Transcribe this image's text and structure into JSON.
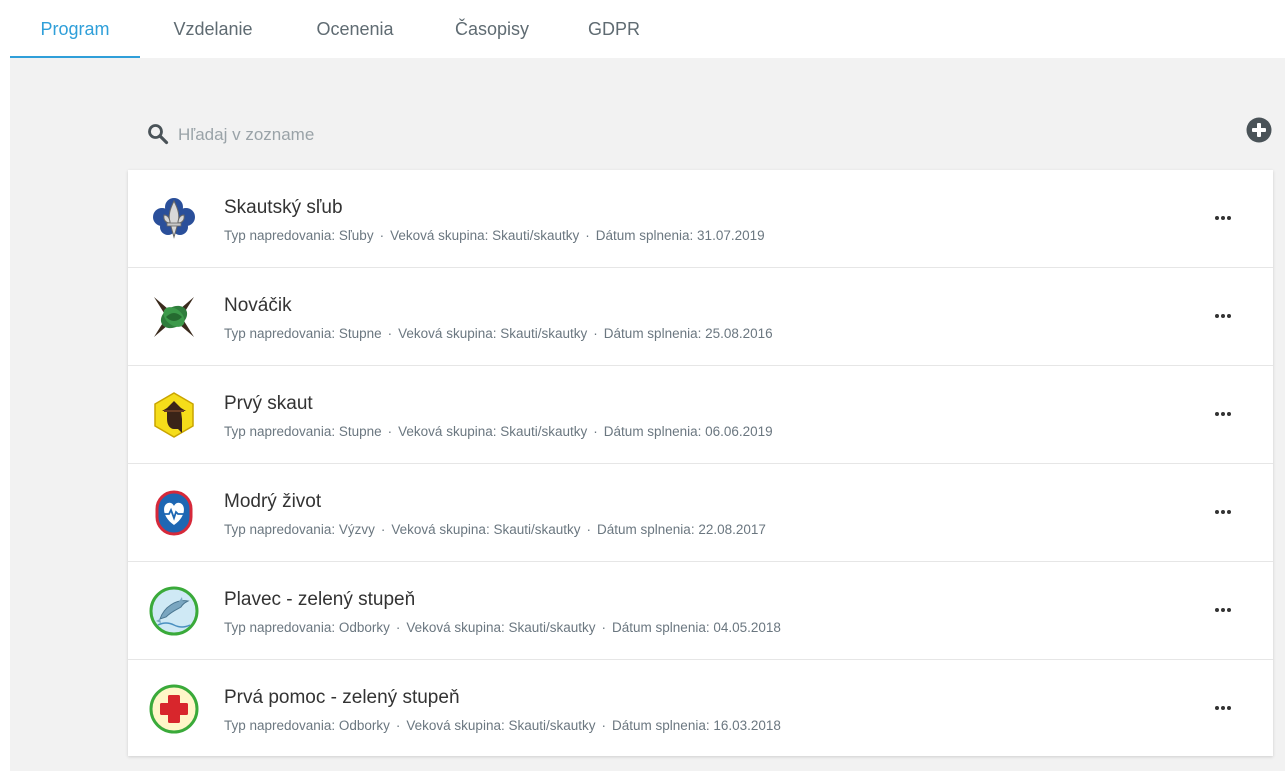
{
  "tabs": [
    {
      "label": "Program",
      "active": true
    },
    {
      "label": "Vzdelanie",
      "active": false
    },
    {
      "label": "Ocenenia",
      "active": false
    },
    {
      "label": "Časopisy",
      "active": false
    },
    {
      "label": "GDPR",
      "active": false
    }
  ],
  "colors": {
    "accent": "#2f9fd9",
    "background": "#f2f2f2"
  },
  "search": {
    "placeholder": "Hľadaj v zozname",
    "value": "",
    "icon": "search-icon"
  },
  "add_icon": "plus-circle-icon",
  "meta_labels": {
    "type": "Typ napredovania:",
    "age": "Veková skupina:",
    "date": "Dátum splnenia:"
  },
  "items": [
    {
      "title": "Skautský sľub",
      "type": "Sľuby",
      "age": "Skauti/skautky",
      "date": "31.07.2019",
      "icon": "scout-lily-icon"
    },
    {
      "title": "Nováčik",
      "type": "Stupne",
      "age": "Skauti/skautky",
      "date": "25.08.2016",
      "icon": "knot-icon"
    },
    {
      "title": "Prvý skaut",
      "type": "Stupne",
      "age": "Skauti/skautky",
      "date": "06.06.2019",
      "icon": "scout-hat-hexagon-icon"
    },
    {
      "title": "Modrý život",
      "type": "Výzvy",
      "age": "Skauti/skautky",
      "date": "22.08.2017",
      "icon": "heart-pulse-icon"
    },
    {
      "title": "Plavec - zelený stupeň",
      "type": "Odborky",
      "age": "Skauti/skautky",
      "date": "04.05.2018",
      "icon": "dolphin-icon"
    },
    {
      "title": "Prvá pomoc - zelený stupeň",
      "type": "Odborky",
      "age": "Skauti/skautky",
      "date": "16.03.2018",
      "icon": "red-cross-icon"
    }
  ]
}
